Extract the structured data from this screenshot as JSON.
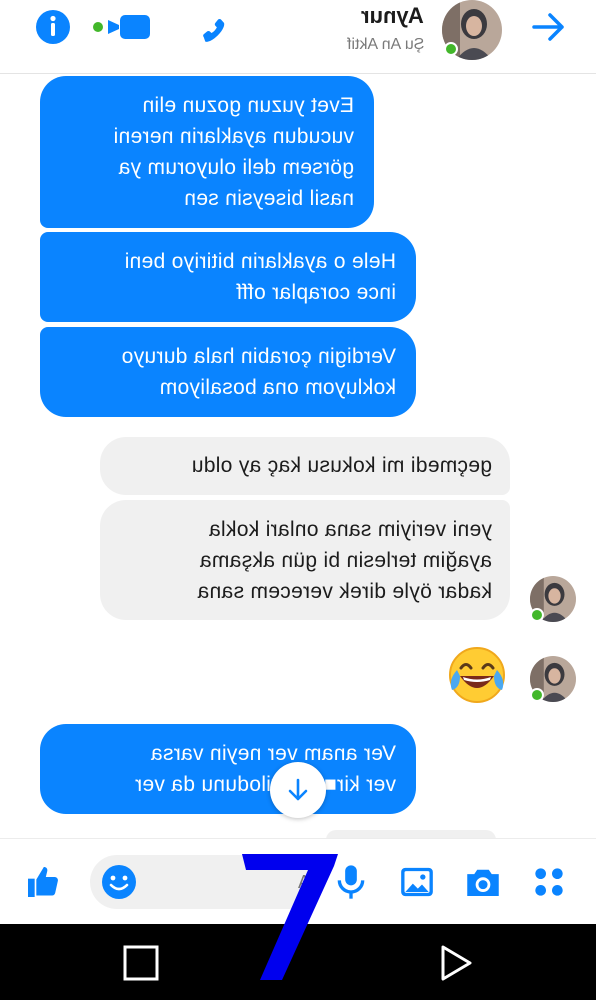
{
  "header": {
    "contact_name": "Aynur",
    "contact_status": "Şu An Aktif",
    "icons": [
      "info-icon",
      "video-call-icon",
      "phone-icon",
      "forward-arrow-icon"
    ]
  },
  "messages": [
    {
      "side": "sent",
      "text": "Evet yuzun gozun elin\nvucudun ayaklarin nereni\ngörsem deli oluyorum ya\nnasil biseysin sen"
    },
    {
      "side": "sent",
      "text": "Hele o ayaklarin bitiriyo beni\nince coraplar offf"
    },
    {
      "side": "sent",
      "text": "Verdigin çorabin hala duruyo\nkokluyom ona bosaliyom"
    },
    {
      "side": "received",
      "text": "geçmedi mi kokusu kaç ay oldu"
    },
    {
      "side": "received",
      "text": "yeni veriyim sana onlari kokla\nayağim terlesin bi gün akşama\nkadar öyle direk verecem sana"
    },
    {
      "side": "received",
      "emoji": "face-with-tears-of-joy"
    },
    {
      "side": "sent",
      "text": "Ver anam ver neyin varsa\nver kir■■■li kilodunu da ver"
    }
  ],
  "composer": {
    "input_value": "",
    "input_placeholder": "A",
    "icons": [
      "thumbs-up-icon",
      "emoji-icon",
      "microphone-icon",
      "gallery-icon",
      "camera-icon",
      "apps-grid-icon"
    ]
  },
  "navbar": {
    "icons": [
      "recent-apps-icon",
      "back-icon"
    ]
  },
  "colors": {
    "accent": "#0a84ff",
    "received_bubble": "#f0f0f0",
    "online": "#42b72a",
    "navbar": "#000000",
    "scribble": "#0000ee"
  }
}
